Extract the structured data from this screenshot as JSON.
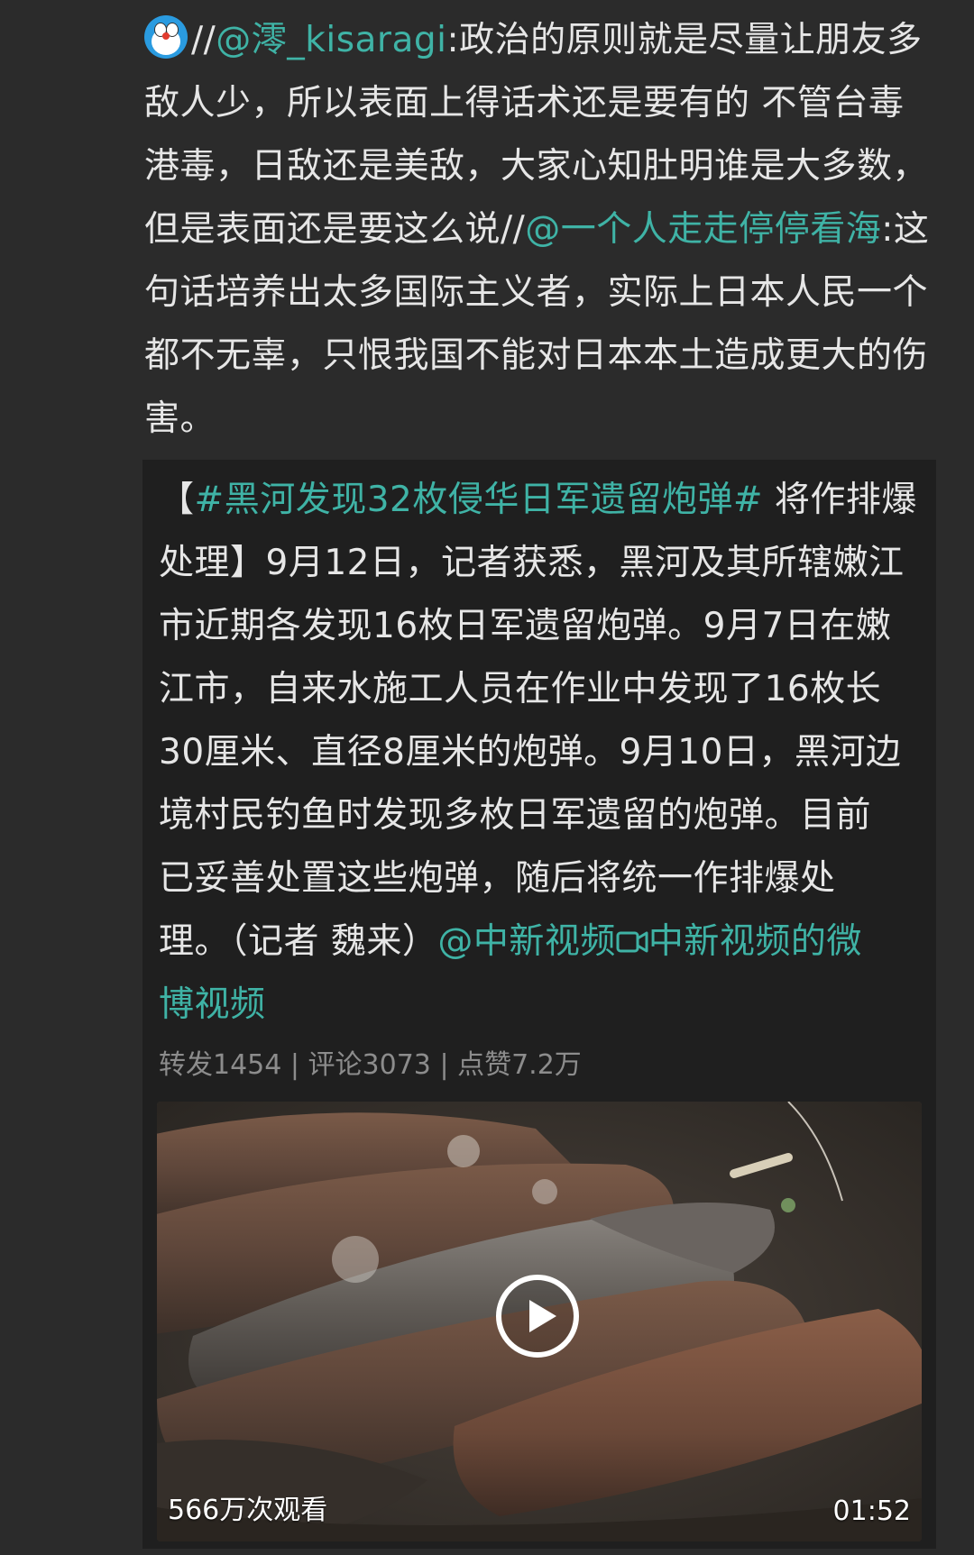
{
  "comment": {
    "avatar_icon": "doraemon-emoji-icon",
    "prefix": "//",
    "mention_1": "@澪_kisaragi",
    "text_1": ":政治的原则就是尽量让朋友多敌人少，所以表面上得话术还是要有的  不管台毒港毒，日敌还是美敌，大家心知肚明谁是大多数，但是表面还是要这么说//",
    "mention_2": "@一个人走走停停看海",
    "text_2": ":这句话培养出太多国际主义者，实际上日本人民一个都不无辜，只恨我国不能对日本本土造成更大的伤害。"
  },
  "quoted_post": {
    "lines": [
      {
        "pre": "【",
        "topic": "#黑河发现32枚侵华日军遗留炮弹#",
        "post": " 将作排爆"
      },
      {
        "pre": "处理】9月12日，记者获悉，黑河及其所辖嫩江",
        "topic": "",
        "post": ""
      },
      {
        "pre": "市近期各发现16枚日军遗留炮弹。9月7日在嫩",
        "topic": "",
        "post": ""
      },
      {
        "pre": "江市，自来水施工人员在作业中发现了16枚长",
        "topic": "",
        "post": ""
      },
      {
        "pre": "30厘米、直径8厘米的炮弹。9月10日，黑河边",
        "topic": "",
        "post": ""
      },
      {
        "pre": "境村民钓鱼时发现多枚日军遗留的炮弹。目前",
        "topic": "",
        "post": ""
      },
      {
        "pre": "已妥善处置这些炮弹，随后将统一作排爆处",
        "topic": "",
        "post": ""
      },
      {
        "pre": "理。（记者 魏来）",
        "topic": "@中新视频",
        "post": ""
      }
    ],
    "video_link_icon": "video-link-icon",
    "video_link_text": "中新视频的微",
    "video_link_text_2": "博视频",
    "stats": {
      "reposts_label": "转发1454",
      "comments_label": "评论3073",
      "likes_label": "点赞7.2万",
      "separator": " | "
    },
    "video": {
      "views": "566万次观看",
      "duration": "01:52",
      "play_icon": "play-icon"
    }
  },
  "colors": {
    "background": "#2b2b2b",
    "card": "#1f1f1f",
    "link": "#3fb3a6",
    "text": "#e6e6e6",
    "meta": "#8c8c8c"
  }
}
